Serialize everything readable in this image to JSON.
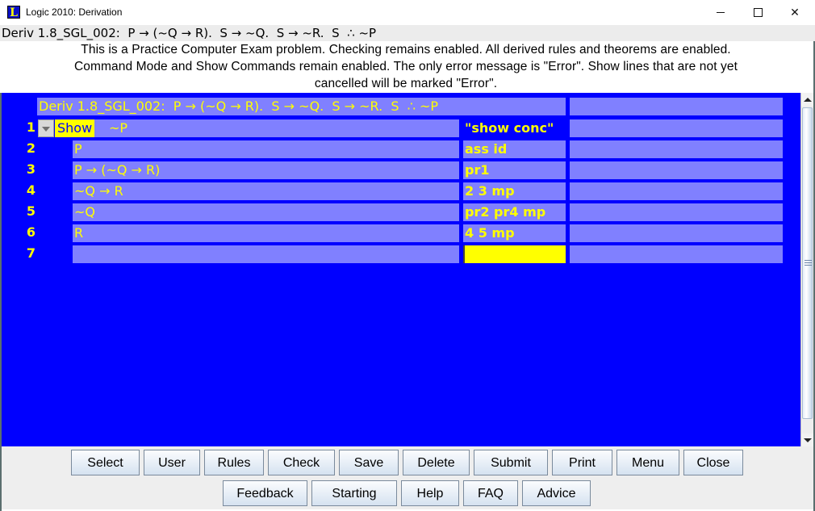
{
  "window": {
    "title": "Logic 2010: Derivation",
    "logo_letter": "L",
    "minimize_glyph": "—",
    "maximize_glyph": "☐",
    "close_glyph": "✕"
  },
  "problem": {
    "title": "Deriv 1.8_SGL_002:  P → (~Q → R).  S → ~Q.  S → ~R.  S  ∴ ~P"
  },
  "instructions": [
    "This is a Practice Computer Exam problem.  Checking remains enabled.  All derived rules and theorems are enabled.",
    "Command Mode and Show Commands remain enabled.  The only error message is \"Error\".  Show lines that are not yet",
    "cancelled will be marked \"Error\"."
  ],
  "derivation": {
    "header": "Deriv 1.8_SGL_002:  P → (~Q → R).  S → ~Q.  S → ~R.  S  ∴ ~P",
    "show_keyword": "Show",
    "lines": [
      {
        "num": "1",
        "formula": "~P",
        "justification": "\"show conc\"",
        "comment": ""
      },
      {
        "num": "2",
        "formula": "P",
        "justification": "ass id",
        "comment": ""
      },
      {
        "num": "3",
        "formula": "P → (~Q → R)",
        "justification": "pr1",
        "comment": ""
      },
      {
        "num": "4",
        "formula": "~Q → R",
        "justification": "2 3 mp",
        "comment": ""
      },
      {
        "num": "5",
        "formula": "~Q",
        "justification": "pr2 pr4 mp",
        "comment": ""
      },
      {
        "num": "6",
        "formula": "R",
        "justification": "4 5 mp",
        "comment": ""
      },
      {
        "num": "7",
        "formula": "",
        "justification": "",
        "comment": ""
      }
    ]
  },
  "colors": {
    "background": "#0000ff",
    "cell": "#8080ff",
    "text": "#ffff00",
    "active_cell": "#ffff00"
  },
  "buttons": {
    "row1": [
      "Select",
      "User",
      "Rules",
      "Check",
      "Save",
      "Delete",
      "Submit",
      "Print",
      "Menu",
      "Close"
    ],
    "row2": [
      "Feedback",
      "Starting",
      "Help",
      "FAQ",
      "Advice"
    ]
  }
}
